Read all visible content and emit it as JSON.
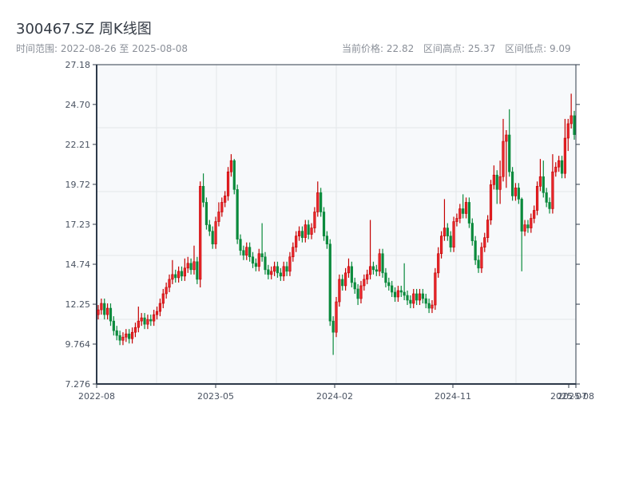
{
  "header": {
    "title": "300467.SZ 周K线图",
    "range_label": "时间范围: 2022-08-26 至 2025-08-08",
    "current_price": "当前价格: 22.82",
    "range_high": "区间高点: 25.37",
    "range_low": "区间低点: 9.09"
  },
  "chart_data": {
    "type": "candlestick",
    "title": "300467.SZ 周K线图",
    "interval": "weekly",
    "start_date": "2022-08-26",
    "end_date": "2025-08-08",
    "ylim": [
      7.276,
      27.18
    ],
    "y_ticks": [
      "27.18",
      "24.70",
      "22.21",
      "19.72",
      "17.23",
      "14.74",
      "12.25",
      "9.764",
      "7.276"
    ],
    "x_ticks": [
      "2022-08",
      "2023-05",
      "2024-02",
      "2024-11",
      "2025-07",
      "2025-08"
    ],
    "grid": true,
    "colors": {
      "up": "#e8262b",
      "up_border": "#c40000",
      "down": "#0a8a3c",
      "axis": "#2e3a4a",
      "grid": "#e3e6ea",
      "background": "#f7f9fb"
    },
    "candle_format": [
      "open",
      "high",
      "low",
      "close"
    ],
    "candles": [
      [
        11.6,
        12.2,
        11.3,
        11.9
      ],
      [
        11.9,
        12.6,
        11.6,
        12.3
      ],
      [
        12.3,
        12.6,
        11.3,
        11.6
      ],
      [
        11.6,
        12.3,
        11.3,
        12.0
      ],
      [
        12.0,
        12.3,
        10.9,
        11.2
      ],
      [
        11.2,
        11.5,
        10.3,
        10.6
      ],
      [
        10.6,
        10.9,
        10.0,
        10.3
      ],
      [
        10.3,
        10.6,
        9.7,
        10.0
      ],
      [
        10.0,
        10.5,
        9.7,
        10.2
      ],
      [
        10.2,
        10.7,
        9.9,
        10.4
      ],
      [
        10.4,
        10.7,
        9.8,
        10.1
      ],
      [
        10.1,
        10.8,
        9.8,
        10.5
      ],
      [
        10.5,
        11.1,
        10.2,
        10.8
      ],
      [
        10.8,
        12.1,
        10.5,
        11.2
      ],
      [
        11.2,
        11.7,
        10.9,
        11.4
      ],
      [
        11.4,
        11.7,
        10.7,
        11.0
      ],
      [
        11.0,
        11.6,
        10.7,
        11.3
      ],
      [
        11.3,
        11.6,
        10.9,
        11.2
      ],
      [
        11.2,
        11.9,
        10.9,
        11.6
      ],
      [
        11.6,
        12.1,
        11.3,
        11.8
      ],
      [
        11.8,
        12.6,
        11.5,
        12.3
      ],
      [
        12.3,
        13.2,
        12.0,
        12.9
      ],
      [
        12.9,
        13.6,
        12.6,
        13.3
      ],
      [
        13.3,
        14.1,
        13.0,
        13.8
      ],
      [
        13.8,
        15.0,
        13.5,
        14.1
      ],
      [
        14.1,
        14.4,
        13.6,
        13.9
      ],
      [
        13.9,
        14.6,
        13.6,
        14.3
      ],
      [
        14.3,
        14.6,
        13.7,
        14.0
      ],
      [
        14.0,
        15.1,
        13.7,
        14.5
      ],
      [
        14.5,
        15.2,
        14.2,
        14.8
      ],
      [
        14.8,
        15.1,
        14.1,
        14.4
      ],
      [
        14.4,
        15.9,
        14.1,
        14.9
      ],
      [
        14.9,
        15.2,
        13.5,
        13.8
      ],
      [
        13.8,
        19.9,
        13.3,
        19.6
      ],
      [
        19.6,
        20.4,
        18.3,
        18.6
      ],
      [
        18.6,
        18.9,
        16.9,
        17.2
      ],
      [
        17.2,
        17.5,
        16.5,
        16.8
      ],
      [
        16.8,
        17.1,
        15.7,
        16.0
      ],
      [
        16.0,
        17.7,
        15.7,
        17.4
      ],
      [
        17.4,
        18.6,
        17.1,
        18.0
      ],
      [
        18.0,
        18.9,
        17.7,
        18.6
      ],
      [
        18.6,
        19.3,
        18.3,
        19.0
      ],
      [
        19.0,
        20.8,
        18.7,
        20.5
      ],
      [
        20.5,
        21.6,
        20.2,
        21.2
      ],
      [
        21.2,
        21.3,
        19.1,
        19.4
      ],
      [
        19.4,
        19.7,
        16.0,
        16.3
      ],
      [
        16.3,
        16.6,
        15.3,
        15.6
      ],
      [
        15.6,
        15.9,
        15.0,
        15.3
      ],
      [
        15.3,
        16.1,
        15.0,
        15.8
      ],
      [
        15.8,
        16.1,
        14.9,
        15.2
      ],
      [
        15.2,
        15.5,
        14.5,
        14.8
      ],
      [
        14.8,
        15.1,
        14.3,
        14.6
      ],
      [
        14.6,
        15.7,
        14.3,
        15.4
      ],
      [
        15.4,
        17.3,
        14.9,
        15.2
      ],
      [
        15.2,
        15.5,
        14.1,
        14.4
      ],
      [
        14.4,
        14.7,
        13.8,
        14.1
      ],
      [
        14.1,
        14.6,
        13.8,
        14.3
      ],
      [
        14.3,
        14.9,
        14.0,
        14.6
      ],
      [
        14.6,
        14.9,
        13.9,
        14.2
      ],
      [
        14.2,
        14.5,
        13.7,
        14.0
      ],
      [
        14.0,
        14.9,
        13.7,
        14.6
      ],
      [
        14.6,
        14.9,
        14.0,
        14.3
      ],
      [
        14.3,
        15.5,
        14.0,
        15.2
      ],
      [
        15.2,
        16.1,
        14.9,
        15.8
      ],
      [
        15.8,
        16.8,
        15.5,
        16.5
      ],
      [
        16.5,
        17.1,
        16.2,
        16.8
      ],
      [
        16.8,
        17.1,
        16.1,
        16.4
      ],
      [
        16.4,
        17.5,
        16.1,
        17.2
      ],
      [
        17.2,
        17.5,
        16.3,
        16.6
      ],
      [
        16.6,
        17.3,
        16.3,
        17.0
      ],
      [
        17.0,
        18.3,
        16.7,
        18.0
      ],
      [
        18.0,
        19.9,
        17.7,
        19.2
      ],
      [
        19.2,
        19.5,
        17.7,
        18.0
      ],
      [
        18.0,
        18.3,
        16.2,
        16.5
      ],
      [
        16.5,
        16.8,
        15.7,
        16.0
      ],
      [
        16.0,
        16.3,
        10.9,
        11.2
      ],
      [
        11.2,
        11.5,
        9.09,
        10.5
      ],
      [
        10.5,
        12.7,
        10.2,
        12.4
      ],
      [
        12.4,
        14.1,
        12.1,
        13.8
      ],
      [
        13.8,
        14.1,
        13.1,
        13.4
      ],
      [
        13.4,
        14.5,
        13.1,
        14.2
      ],
      [
        14.2,
        15.1,
        13.9,
        14.6
      ],
      [
        14.6,
        14.9,
        13.3,
        13.6
      ],
      [
        13.6,
        13.9,
        12.9,
        13.2
      ],
      [
        13.2,
        13.5,
        12.2,
        12.6
      ],
      [
        12.6,
        13.7,
        12.3,
        13.4
      ],
      [
        13.4,
        14.1,
        13.1,
        13.8
      ],
      [
        13.8,
        14.4,
        13.5,
        14.1
      ],
      [
        14.1,
        17.5,
        13.8,
        14.6
      ],
      [
        14.6,
        14.9,
        14.1,
        14.4
      ],
      [
        14.4,
        14.7,
        14.0,
        14.3
      ],
      [
        14.3,
        15.7,
        14.0,
        15.4
      ],
      [
        15.4,
        15.7,
        13.9,
        14.2
      ],
      [
        14.2,
        14.5,
        13.3,
        13.6
      ],
      [
        13.6,
        13.9,
        13.1,
        13.4
      ],
      [
        13.4,
        13.7,
        12.7,
        13.0
      ],
      [
        13.0,
        13.3,
        12.4,
        12.7
      ],
      [
        12.7,
        13.4,
        12.4,
        13.1
      ],
      [
        13.1,
        13.4,
        12.7,
        13.0
      ],
      [
        13.0,
        14.8,
        12.5,
        12.8
      ],
      [
        12.8,
        13.1,
        12.2,
        12.5
      ],
      [
        12.5,
        12.8,
        12.0,
        12.3
      ],
      [
        12.3,
        13.2,
        12.0,
        12.9
      ],
      [
        12.9,
        13.2,
        12.2,
        12.5
      ],
      [
        12.5,
        13.2,
        12.2,
        12.9
      ],
      [
        12.9,
        13.2,
        12.3,
        12.6
      ],
      [
        12.6,
        12.9,
        12.0,
        12.3
      ],
      [
        12.3,
        12.6,
        11.7,
        12.0
      ],
      [
        12.0,
        12.5,
        11.7,
        12.2
      ],
      [
        12.2,
        14.5,
        11.9,
        14.2
      ],
      [
        14.2,
        15.8,
        13.9,
        15.4
      ],
      [
        15.4,
        16.8,
        15.1,
        16.5
      ],
      [
        16.5,
        18.8,
        16.2,
        17.0
      ],
      [
        17.0,
        17.3,
        16.2,
        16.5
      ],
      [
        16.5,
        16.8,
        15.5,
        15.8
      ],
      [
        15.8,
        17.7,
        15.5,
        17.4
      ],
      [
        17.4,
        17.9,
        17.1,
        17.6
      ],
      [
        17.6,
        18.5,
        17.3,
        18.2
      ],
      [
        18.2,
        19.1,
        17.6,
        17.9
      ],
      [
        17.9,
        18.9,
        17.6,
        18.6
      ],
      [
        18.6,
        18.9,
        17.0,
        17.3
      ],
      [
        17.3,
        17.6,
        15.9,
        16.2
      ],
      [
        16.2,
        16.5,
        14.7,
        15.0
      ],
      [
        15.0,
        15.3,
        14.2,
        14.5
      ],
      [
        14.5,
        16.1,
        14.2,
        15.8
      ],
      [
        15.8,
        16.7,
        15.5,
        16.4
      ],
      [
        16.4,
        17.8,
        16.1,
        17.5
      ],
      [
        17.5,
        20.0,
        17.2,
        19.7
      ],
      [
        19.7,
        20.9,
        19.4,
        20.3
      ],
      [
        20.3,
        20.6,
        18.5,
        19.4
      ],
      [
        19.4,
        21.2,
        18.5,
        20.2
      ],
      [
        20.2,
        23.8,
        19.9,
        22.4
      ],
      [
        22.4,
        23.1,
        19.5,
        22.8
      ],
      [
        22.8,
        24.4,
        20.2,
        20.5
      ],
      [
        20.5,
        20.8,
        18.7,
        19.0
      ],
      [
        19.0,
        19.8,
        18.7,
        19.5
      ],
      [
        19.5,
        19.8,
        18.5,
        18.8
      ],
      [
        18.8,
        18.9,
        14.3,
        16.8
      ],
      [
        16.8,
        17.5,
        16.5,
        17.2
      ],
      [
        17.2,
        17.5,
        16.7,
        17.0
      ],
      [
        17.0,
        17.9,
        16.7,
        17.6
      ],
      [
        17.6,
        18.4,
        17.3,
        18.1
      ],
      [
        18.1,
        19.9,
        17.8,
        19.6
      ],
      [
        19.6,
        21.3,
        19.3,
        20.2
      ],
      [
        20.2,
        21.2,
        18.9,
        19.2
      ],
      [
        19.2,
        19.5,
        18.3,
        18.6
      ],
      [
        18.6,
        18.9,
        17.9,
        18.2
      ],
      [
        18.2,
        21.6,
        17.9,
        20.5
      ],
      [
        20.5,
        21.1,
        20.2,
        20.8
      ],
      [
        20.8,
        21.5,
        20.5,
        21.2
      ],
      [
        21.2,
        21.5,
        20.1,
        20.4
      ],
      [
        20.4,
        23.8,
        20.1,
        22.6
      ],
      [
        22.6,
        23.8,
        21.8,
        23.5
      ],
      [
        23.5,
        25.37,
        23.2,
        24.0
      ],
      [
        24.0,
        24.3,
        22.5,
        22.82
      ]
    ]
  }
}
